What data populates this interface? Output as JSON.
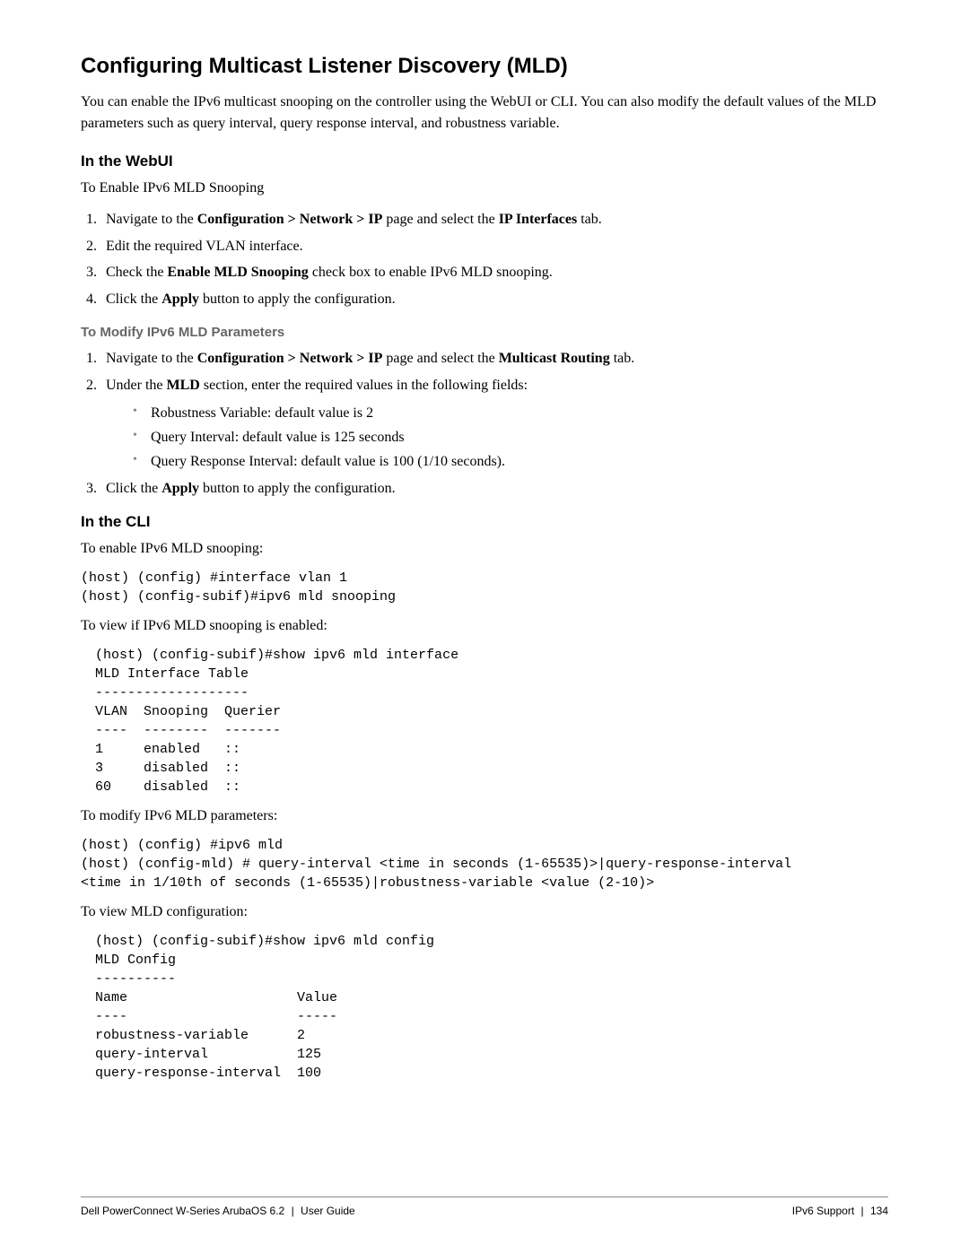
{
  "title": "Configuring Multicast Listener Discovery (MLD)",
  "intro": "You can enable the IPv6 multicast snooping on the controller using the WebUI or CLI. You can also modify the default values of the MLD parameters such as query interval, query response interval, and robustness variable.",
  "webui": {
    "heading": "In the WebUI",
    "lead": "To Enable IPv6 MLD Snooping",
    "step1_a": "Navigate to the ",
    "step1_b": "Configuration > Network > IP",
    "step1_c": " page and select the ",
    "step1_d": "IP Interfaces",
    "step1_e": " tab.",
    "step2": "Edit the required VLAN interface.",
    "step3_a": "Check the ",
    "step3_b": "Enable MLD Snooping",
    "step3_c": " check box to enable IPv6 MLD snooping.",
    "step4_a": "Click the ",
    "step4_b": "Apply",
    "step4_c": " button to apply the configuration."
  },
  "modify": {
    "heading": "To Modify IPv6 MLD Parameters",
    "step1_a": "Navigate to the ",
    "step1_b": "Configuration > Network > IP",
    "step1_c": " page and select the ",
    "step1_d": "Multicast Routing",
    "step1_e": " tab.",
    "step2_a": "Under the ",
    "step2_b": "MLD",
    "step2_c": " section, enter the required values in the following fields:",
    "b1": "Robustness Variable: default value is 2",
    "b2": "Query Interval: default value is 125 seconds",
    "b3": "Query Response Interval: default value is 100 (1/10 seconds).",
    "step3_a": "Click the ",
    "step3_b": "Apply",
    "step3_c": " button to apply the configuration."
  },
  "cli": {
    "heading": "In the CLI",
    "lead1": "To enable IPv6 MLD snooping:",
    "code1": "(host) (config) #interface vlan 1\n(host) (config-subif)#ipv6 mld snooping",
    "lead2": "To view if IPv6 MLD snooping is enabled:",
    "code2": "(host) (config-subif)#show ipv6 mld interface\nMLD Interface Table\n-------------------\nVLAN  Snooping  Querier\n----  --------  -------\n1     enabled   ::\n3     disabled  ::\n60    disabled  ::",
    "lead3": "To modify IPv6 MLD parameters:",
    "code3": "(host) (config) #ipv6 mld\n(host) (config-mld) # query-interval <time in seconds (1-65535)>|query-response-interval\n<time in 1/10th of seconds (1-65535)|robustness-variable <value (2-10)>",
    "lead4": "To view MLD configuration:",
    "code4": "(host) (config-subif)#show ipv6 mld config\nMLD Config\n----------\nName                     Value\n----                     -----\nrobustness-variable      2\nquery-interval           125\nquery-response-interval  100"
  },
  "footer": {
    "left": "Dell PowerConnect W-Series ArubaOS 6.2",
    "left_sep": "|",
    "left_suffix": "User Guide",
    "right_prefix": "IPv6 Support",
    "right_sep": "|",
    "right_page": "134"
  }
}
